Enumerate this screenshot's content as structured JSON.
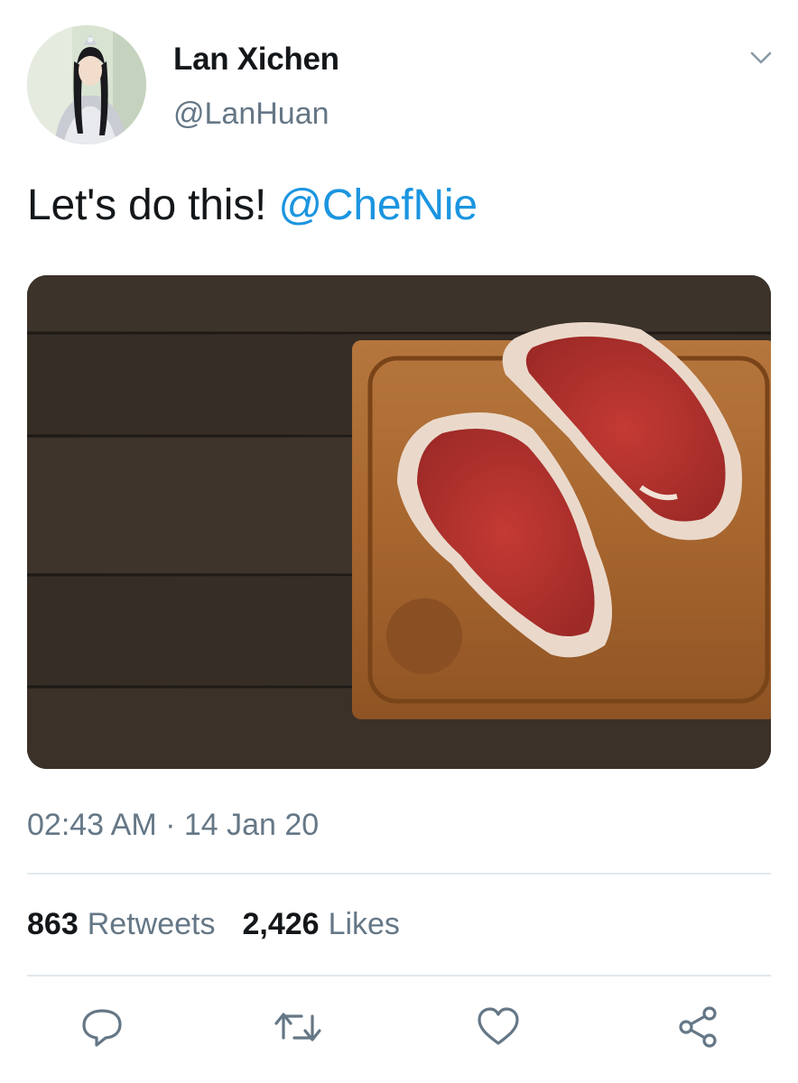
{
  "author": {
    "display_name": "Lan Xichen",
    "handle": "@LanHuan",
    "avatar_icon": "profile-avatar"
  },
  "tweet": {
    "text": "Let's do this!",
    "mention": "@ChefNie",
    "image_description": "Two raw steaks on a wooden cutting board on a dark wood table",
    "timestamp": "02:43 AM · 14 Jan 20"
  },
  "stats": {
    "retweets_count": "863",
    "retweets_label": "Retweets",
    "likes_count": "2,426",
    "likes_label": "Likes"
  },
  "actions": [
    {
      "name": "reply",
      "icon": "speech-bubble-icon"
    },
    {
      "name": "retweet",
      "icon": "retweet-arrows-icon"
    },
    {
      "name": "like",
      "icon": "heart-icon"
    },
    {
      "name": "share",
      "icon": "share-nodes-icon"
    }
  ],
  "colors": {
    "text_primary": "#14171a",
    "text_secondary": "#657786",
    "mention": "#1b95e0",
    "divider": "#e1e8ed"
  }
}
